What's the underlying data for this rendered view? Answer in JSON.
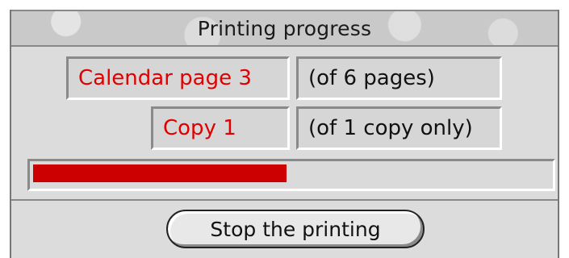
{
  "window": {
    "title": "Printing progress"
  },
  "status": {
    "page_label": "Calendar page 3",
    "page_total": "(of 6 pages)",
    "copy_label": "Copy 1",
    "copy_total": "(of 1 copy only)"
  },
  "progress": {
    "fraction": 0.49,
    "color": "#cc0000"
  },
  "actions": {
    "stop_label": "Stop the printing"
  },
  "colors": {
    "label_red": "#e00000",
    "window_bg": "#dcdcdc"
  }
}
